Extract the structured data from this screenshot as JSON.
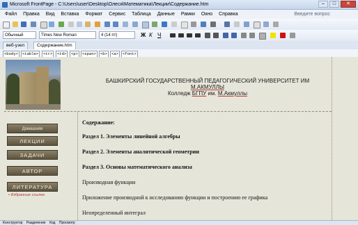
{
  "window": {
    "title": "Microsoft FrontPage - C:\\Users\\user\\Desktop\\Олеся\\Математика\\Лекции\\Содержание.htm",
    "buttons": {
      "minimize": "–",
      "maximize": "□",
      "close": "✕"
    }
  },
  "menu": {
    "items": [
      "Файл",
      "Правка",
      "Вид",
      "Вставка",
      "Формат",
      "Сервис",
      "Таблица",
      "Данные",
      "Рамки",
      "Окно",
      "Справка"
    ],
    "ask_placeholder": "Введите вопрос"
  },
  "formatting": {
    "style": "Обычный",
    "font": "Times New Roman",
    "size": "4 (14 пт)",
    "bold": "Ж",
    "italic": "К",
    "underline": "Ч"
  },
  "tabs": [
    {
      "label": "веб-узел"
    },
    {
      "label": "Содержание.htm"
    }
  ],
  "tags": [
    "<body>",
    "<table>",
    "<tr>",
    "<td>",
    "<p>",
    "<span>",
    "<b>",
    "<a>",
    "<font>"
  ],
  "page": {
    "header_line1": "БАШКИРСКИЙ ГОСУДАРСТВЕННЫЙ ПЕДАГОГИЧЕСКИЙ УНИВЕРСИТЕТ ИМ",
    "header_line2": "М.АКМУЛЛЫ",
    "header_line3_a": "Колледж ",
    "header_line3_b": "БГПУ",
    "header_line3_c": " им. ",
    "header_line3_d": "М.Акмуллы",
    "nav": [
      "Домашняя",
      "ЛЕКЦИИ",
      "ЗАДАЧИ",
      "АВТОР",
      "ЛИТЕРАТУРА"
    ],
    "favorites_link": "Избранные ссылки",
    "contents_title": "Содержание:",
    "sections": [
      "Раздел 1. Элементы линейной алгебры",
      "Раздел 2. Элементы аналитической геометрии",
      "Раздел 3. Основы математического анализа"
    ],
    "items": [
      "Производная функции",
      "Приложение производной к исследованию функции и построению ее графика",
      "Неопределенный интеграл"
    ]
  },
  "status": {
    "view1": "Конструктор",
    "view2": "Разделение",
    "view3": "Код",
    "view4": "Просмотр"
  },
  "colors": {
    "page_bg": "#e6e5da",
    "nav_button": "#6e6450",
    "link_red": "#b03a2e"
  }
}
